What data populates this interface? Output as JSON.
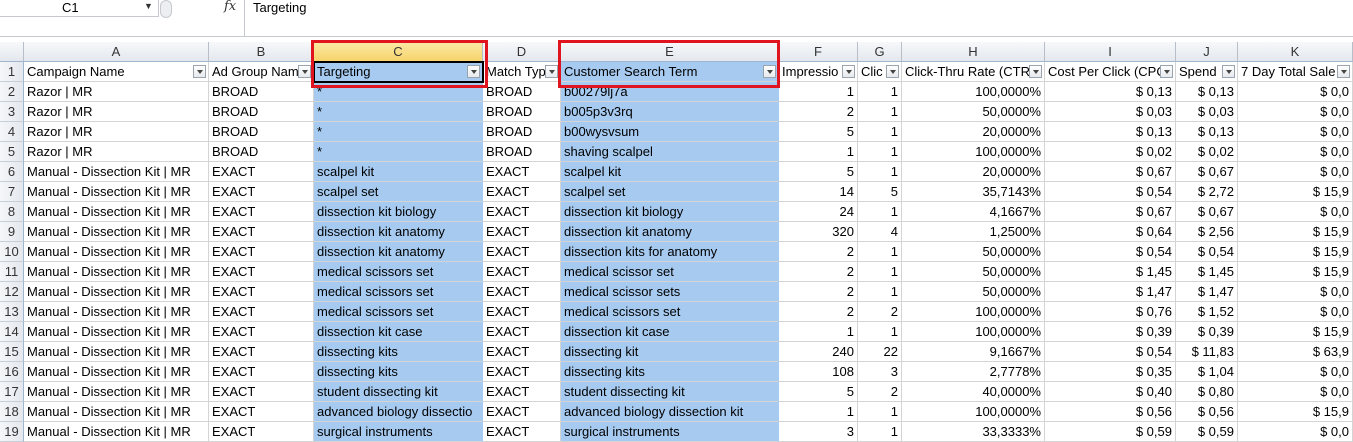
{
  "formula_bar": {
    "name_box": "C1",
    "fx_label": "fx",
    "content": "Targeting"
  },
  "columns": [
    "A",
    "B",
    "C",
    "D",
    "E",
    "F",
    "G",
    "H",
    "I",
    "J",
    "K"
  ],
  "headers": [
    "Campaign Name",
    "Ad Group Nam",
    "Targeting",
    "Match Typ",
    "Customer Search Term",
    "Impressio",
    "Clic",
    "Click-Thru Rate (CTR",
    "Cost Per Click (CPC",
    "Spend",
    "7 Day Total Sale"
  ],
  "rows": [
    [
      "Razor | MR",
      "BROAD",
      "*",
      "BROAD",
      "b00279lj7a",
      "1",
      "1",
      "100,0000%",
      "$ 0,13",
      "$ 0,13",
      "$ 0,0"
    ],
    [
      "Razor | MR",
      "BROAD",
      "*",
      "BROAD",
      "b005p3v3rq",
      "2",
      "1",
      "50,0000%",
      "$ 0,03",
      "$ 0,03",
      "$ 0,0"
    ],
    [
      "Razor | MR",
      "BROAD",
      "*",
      "BROAD",
      "b00wysvsum",
      "5",
      "1",
      "20,0000%",
      "$ 0,13",
      "$ 0,13",
      "$ 0,0"
    ],
    [
      "Razor | MR",
      "BROAD",
      "*",
      "BROAD",
      "shaving scalpel",
      "1",
      "1",
      "100,0000%",
      "$ 0,02",
      "$ 0,02",
      "$ 0,0"
    ],
    [
      "Manual - Dissection Kit | MR",
      "EXACT",
      "scalpel kit",
      "EXACT",
      "scalpel kit",
      "5",
      "1",
      "20,0000%",
      "$ 0,67",
      "$ 0,67",
      "$ 0,0"
    ],
    [
      "Manual - Dissection Kit | MR",
      "EXACT",
      "scalpel set",
      "EXACT",
      "scalpel set",
      "14",
      "5",
      "35,7143%",
      "$ 0,54",
      "$ 2,72",
      "$ 15,9"
    ],
    [
      "Manual - Dissection Kit | MR",
      "EXACT",
      "dissection kit biology",
      "EXACT",
      "dissection kit biology",
      "24",
      "1",
      "4,1667%",
      "$ 0,67",
      "$ 0,67",
      "$ 0,0"
    ],
    [
      "Manual - Dissection Kit | MR",
      "EXACT",
      "dissection kit anatomy",
      "EXACT",
      "dissection kit anatomy",
      "320",
      "4",
      "1,2500%",
      "$ 0,64",
      "$ 2,56",
      "$ 15,9"
    ],
    [
      "Manual - Dissection Kit | MR",
      "EXACT",
      "dissection kit anatomy",
      "EXACT",
      "dissection kits for anatomy",
      "2",
      "1",
      "50,0000%",
      "$ 0,54",
      "$ 0,54",
      "$ 15,9"
    ],
    [
      "Manual - Dissection Kit | MR",
      "EXACT",
      "medical scissors set",
      "EXACT",
      "medical scissor set",
      "2",
      "1",
      "50,0000%",
      "$ 1,45",
      "$ 1,45",
      "$ 15,9"
    ],
    [
      "Manual - Dissection Kit | MR",
      "EXACT",
      "medical scissors set",
      "EXACT",
      "medical scissor sets",
      "2",
      "1",
      "50,0000%",
      "$ 1,47",
      "$ 1,47",
      "$ 0,0"
    ],
    [
      "Manual - Dissection Kit | MR",
      "EXACT",
      "medical scissors set",
      "EXACT",
      "medical scissors set",
      "2",
      "2",
      "100,0000%",
      "$ 0,76",
      "$ 1,52",
      "$ 0,0"
    ],
    [
      "Manual - Dissection Kit | MR",
      "EXACT",
      "dissection kit case",
      "EXACT",
      "dissection kit case",
      "1",
      "1",
      "100,0000%",
      "$ 0,39",
      "$ 0,39",
      "$ 15,9"
    ],
    [
      "Manual - Dissection Kit | MR",
      "EXACT",
      "dissecting kits",
      "EXACT",
      "dissecting kit",
      "240",
      "22",
      "9,1667%",
      "$ 0,54",
      "$ 11,83",
      "$ 63,9"
    ],
    [
      "Manual - Dissection Kit | MR",
      "EXACT",
      "dissecting kits",
      "EXACT",
      "dissecting kits",
      "108",
      "3",
      "2,7778%",
      "$ 0,35",
      "$ 1,04",
      "$ 0,0"
    ],
    [
      "Manual - Dissection Kit | MR",
      "EXACT",
      "student dissecting kit",
      "EXACT",
      "student dissecting kit",
      "5",
      "2",
      "40,0000%",
      "$ 0,40",
      "$ 0,80",
      "$ 0,0"
    ],
    [
      "Manual - Dissection Kit | MR",
      "EXACT",
      "advanced biology dissectio",
      "EXACT",
      "advanced biology dissection kit",
      "1",
      "1",
      "100,0000%",
      "$ 0,56",
      "$ 0,56",
      "$ 15,9"
    ],
    [
      "Manual - Dissection Kit | MR",
      "EXACT",
      "surgical instruments",
      "EXACT",
      "surgical instruments",
      "3",
      "1",
      "33,3333%",
      "$ 0,59",
      "$ 0,59",
      "$ 0,0"
    ]
  ],
  "colors": {
    "highlight": "#a6caf0",
    "annotation": "#e0141e",
    "selected_header": "#f7d36b"
  }
}
